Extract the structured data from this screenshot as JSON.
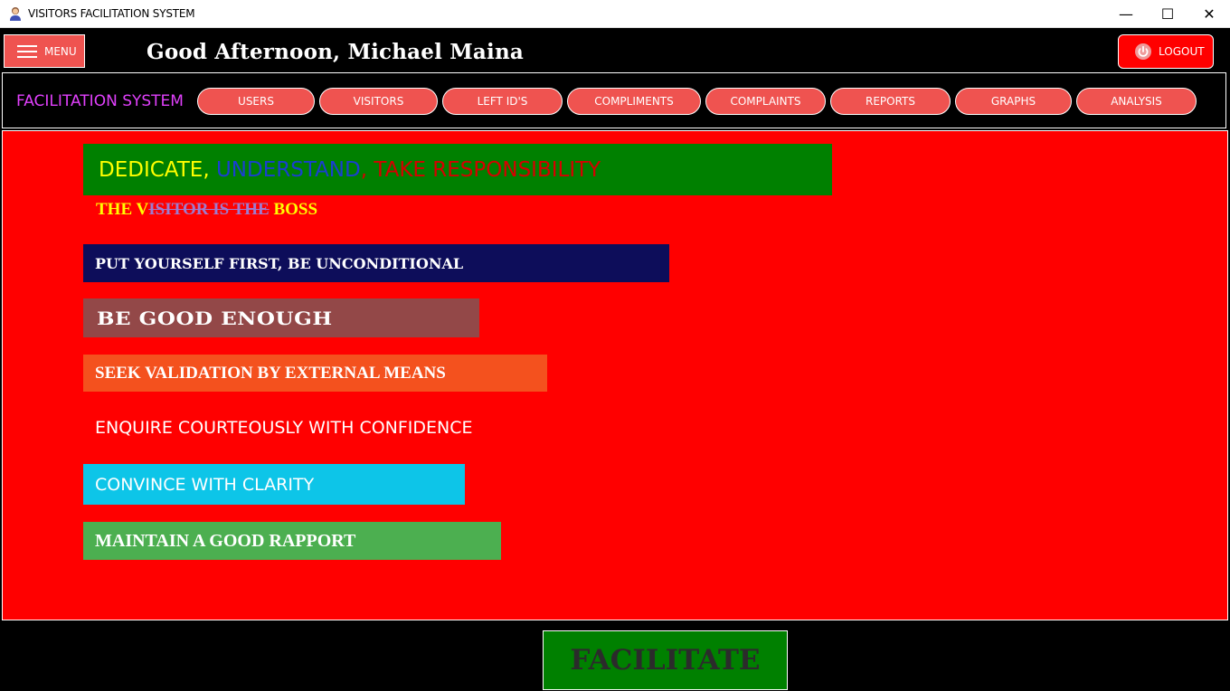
{
  "window": {
    "title": "VISITORS FACILITATION SYSTEM",
    "app_icon": "user-icon",
    "controls": {
      "minimize": "—",
      "maximize": "☐",
      "close": "✕"
    }
  },
  "header": {
    "menu_label": "MENU",
    "greeting": "Good Afternoon, Michael Maina",
    "logout_label": "LOGOUT"
  },
  "nav": {
    "title": "FACILITATION SYSTEM",
    "items": [
      {
        "label": "USERS"
      },
      {
        "label": "VISITORS"
      },
      {
        "label": "LEFT ID'S"
      },
      {
        "label": "COMPLIMENTS"
      },
      {
        "label": "COMPLAINTS"
      },
      {
        "label": "REPORTS"
      },
      {
        "label": "GRAPHS"
      },
      {
        "label": "ANALYSIS"
      }
    ]
  },
  "main": {
    "motto": {
      "part1": "DEDICATE,",
      "part2": " UNDERSTAND",
      "part3": ", TAKE RESPONSIBILITY"
    },
    "boss_line": {
      "part1": "THE V",
      "part2": "ISITOR IS THE",
      "part3": " BOSS"
    },
    "banners": [
      "PUT YOURSELF FIRST, BE UNCONDITIONAL",
      "BE GOOD ENOUGH",
      "SEEK VALIDATION BY EXTERNAL MEANS",
      "ENQUIRE COURTEOUSLY WITH CONFIDENCE",
      "CONVINCE WITH CLARITY",
      "MAINTAIN A GOOD RAPPORT"
    ]
  },
  "footer": {
    "facilitate_label": "FACILITATE"
  },
  "colors": {
    "accent": "#ef5350",
    "main_bg": "#ff0000",
    "motto_bg": "#008000",
    "nav_title": "#e040fb"
  }
}
